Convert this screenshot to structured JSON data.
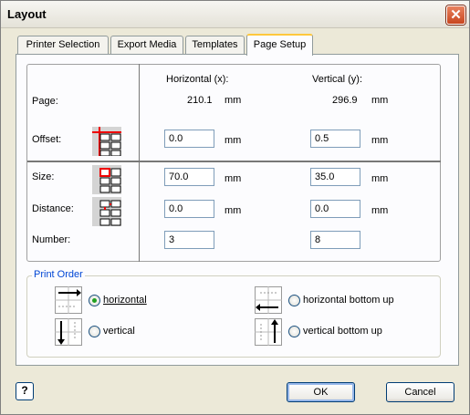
{
  "window": {
    "title": "Layout"
  },
  "tabs": [
    {
      "label": "Printer Selection"
    },
    {
      "label": "Export Media"
    },
    {
      "label": "Templates"
    },
    {
      "label": "Page Setup"
    }
  ],
  "page_setup": {
    "col_horizontal": "Horizontal (x):",
    "col_vertical": "Vertical (y):",
    "unit": "mm",
    "page_label": "Page:",
    "page_h": "210.1",
    "page_v": "296.9",
    "offset_label": "Offset:",
    "offset_h": "0.0",
    "offset_v": "0.5",
    "size_label": "Size:",
    "size_h": "70.0",
    "size_v": "35.0",
    "distance_label": "Distance:",
    "distance_h": "0.0",
    "distance_v": "0.0",
    "number_label": "Number:",
    "number_h": "3",
    "number_v": "8"
  },
  "print_order": {
    "title": "Print Order",
    "options": [
      {
        "label": "horizontal",
        "selected": true
      },
      {
        "label": "vertical",
        "selected": false
      },
      {
        "label": "horizontal bottom up",
        "selected": false
      },
      {
        "label": "vertical bottom up",
        "selected": false
      }
    ]
  },
  "buttons": {
    "ok": "OK",
    "cancel": "Cancel",
    "help": "?"
  }
}
